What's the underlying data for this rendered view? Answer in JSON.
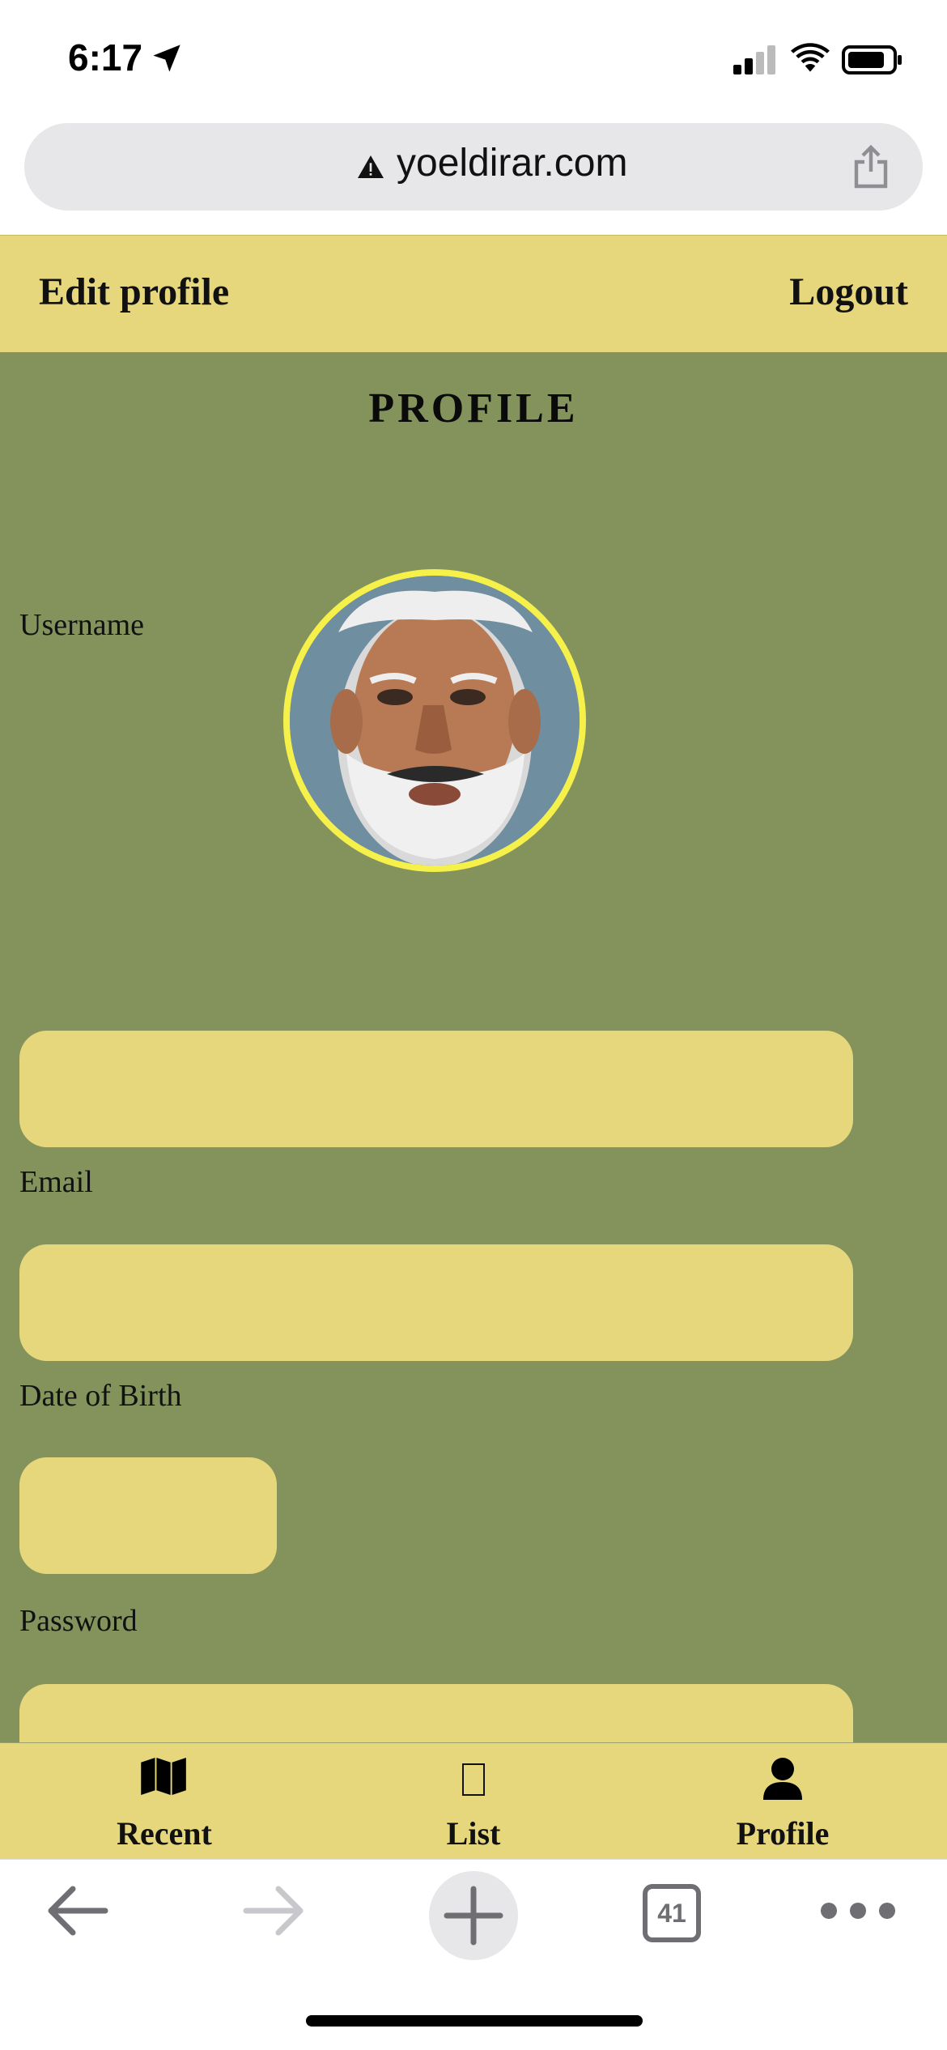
{
  "status_bar": {
    "time": "6:17"
  },
  "browser": {
    "url": "yoeldirar.com",
    "tabs_count": "41"
  },
  "header": {
    "edit_profile": "Edit profile",
    "logout": "Logout"
  },
  "page": {
    "title": "PROFILE"
  },
  "form": {
    "username_label": "Username",
    "email_label": "Email",
    "dob_label": "Date of Birth",
    "password_label": "Password",
    "password_placeholder": "******"
  },
  "bottom_nav": {
    "recent": "Recent",
    "list": "List",
    "profile": "Profile"
  },
  "colors": {
    "header_bg": "#e6d67c",
    "main_bg": "#84935c",
    "avatar_ring": "#f5f04a"
  },
  "icons": [
    "location-arrow-icon",
    "signal-icon",
    "wifi-icon",
    "battery-icon",
    "warning-icon",
    "share-icon",
    "map-icon",
    "list-icon",
    "user-icon",
    "back-arrow-icon",
    "forward-arrow-icon",
    "plus-icon",
    "tabs-icon",
    "more-icon"
  ]
}
